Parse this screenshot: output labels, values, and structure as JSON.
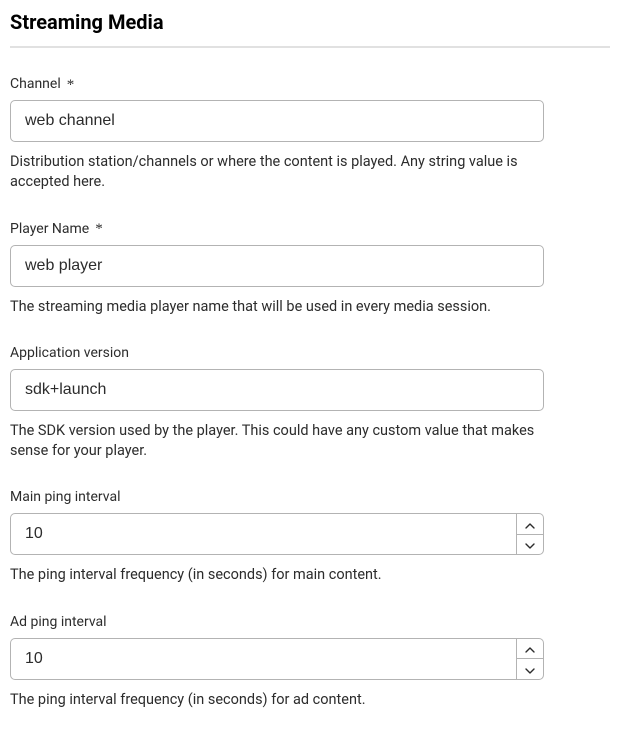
{
  "section": {
    "title": "Streaming Media"
  },
  "fields": {
    "channel": {
      "label": "Channel",
      "required_marker": "*",
      "value": "web channel",
      "help": "Distribution station/channels or where the content is played. Any string value is accepted here."
    },
    "playerName": {
      "label": "Player Name",
      "required_marker": "*",
      "value": "web player",
      "help": "The streaming media player name that will be used in every media session."
    },
    "appVersion": {
      "label": "Application version",
      "value": "sdk+launch",
      "help": "The SDK version used by the player. This could have any custom value that makes sense for your player."
    },
    "mainPingInterval": {
      "label": "Main ping interval",
      "value": "10",
      "help": "The ping interval frequency (in seconds) for main content."
    },
    "adPingInterval": {
      "label": "Ad ping interval",
      "value": "10",
      "help": "The ping interval frequency (in seconds) for ad content."
    }
  }
}
